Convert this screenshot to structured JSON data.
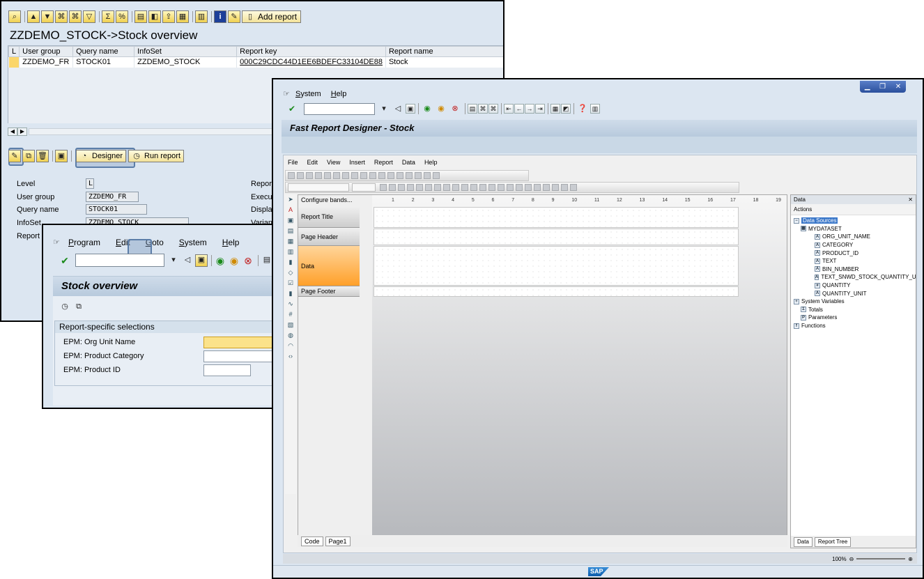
{
  "w1": {
    "add_report": "Add report",
    "title": "ZZDEMO_STOCK->Stock overview",
    "table": {
      "headers": [
        "L",
        "User group",
        "Query name",
        "InfoSet",
        "Report key",
        "Report name"
      ],
      "row": [
        "",
        "ZZDEMO_FR",
        "STOCK01",
        "ZZDEMO_STOCK",
        "000C29CDC44D1EE6BDEFC33104DE88",
        "Stock"
      ]
    },
    "designer_label": "Designer",
    "run_report_label": "Run report",
    "fields": {
      "level_label": "Level",
      "level_value": "L",
      "user_group_label": "User group",
      "user_group_value": "ZZDEMO_FR",
      "query_name_label": "Query name",
      "query_name_value": "STOCK01",
      "infoset_label": "InfoSet",
      "infoset_value": "ZZDEMO_STOCK",
      "report_label": "Report l"
    },
    "right_labels": [
      "Report",
      "Execut",
      "Display",
      "Variant"
    ]
  },
  "w2": {
    "menu": [
      "Program",
      "Edit",
      "Goto",
      "System",
      "Help"
    ],
    "panel_title": "Stock overview",
    "section_title": "Report-specific selections",
    "rows": [
      "EPM: Org Unit Name",
      "EPM: Product Category",
      "EPM: Product ID"
    ]
  },
  "w3": {
    "menu": [
      "System",
      "Help"
    ],
    "panel_title": "Fast Report Designer - Stock",
    "fr_menu": [
      "File",
      "Edit",
      "View",
      "Insert",
      "Report",
      "Data",
      "Help"
    ],
    "configure_bands": "Configure bands...",
    "bands": [
      "Report Title",
      "Page Header",
      "Data",
      "Page Footer"
    ],
    "ruler": [
      "1",
      "2",
      "3",
      "4",
      "5",
      "6",
      "7",
      "8",
      "9",
      "10",
      "11",
      "12",
      "13",
      "14",
      "15",
      "16",
      "17",
      "18",
      "19"
    ],
    "tabs": [
      "Code",
      "Page1"
    ],
    "data_panel_title": "Data",
    "actions": "Actions",
    "tree": {
      "data_sources": "Data Sources",
      "dataset": "MYDATASET",
      "fields": [
        "ORG_UNIT_NAME",
        "CATEGORY",
        "PRODUCT_ID",
        "TEXT",
        "BIN_NUMBER",
        "TEXT_SNWD_STOCK_QUANTITY_U",
        "QUANTITY",
        "QUANTITY_UNIT"
      ],
      "system_variables": "System Variables",
      "totals": "Totals",
      "parameters": "Parameters",
      "functions": "Functions"
    },
    "data_tabs": [
      "Data",
      "Report Tree"
    ],
    "zoom": "100%",
    "sap": "SAP"
  }
}
